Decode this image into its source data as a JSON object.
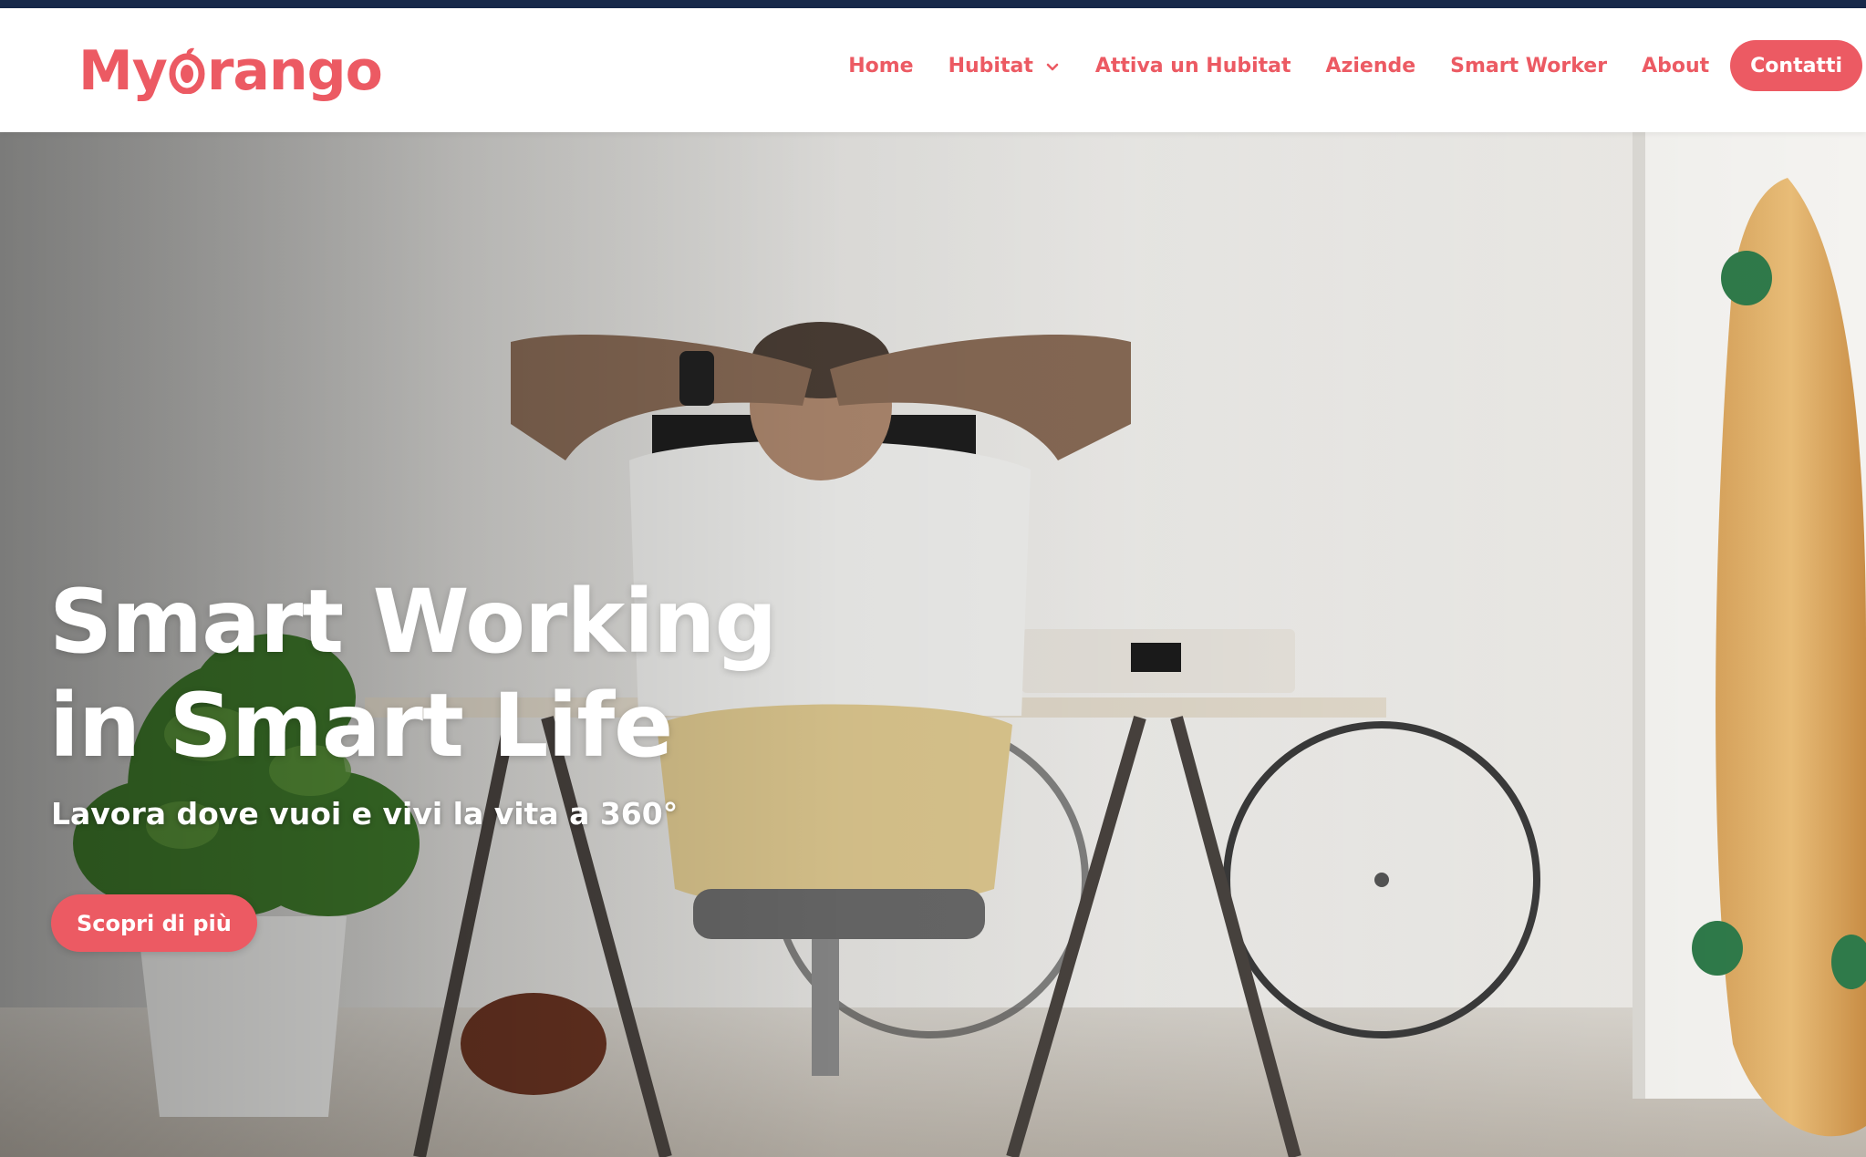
{
  "brand": {
    "name_part1": "My",
    "name_part2": "rango",
    "logo_icon": "orange-o-icon",
    "color": "#ec5a63"
  },
  "nav": {
    "items": [
      {
        "label": "Home"
      },
      {
        "label": "Hubitat",
        "has_dropdown": true
      },
      {
        "label": "Attiva un Hubitat"
      },
      {
        "label": "Aziende"
      },
      {
        "label": "Smart Worker"
      },
      {
        "label": "About"
      }
    ],
    "cta_label": "Contatti"
  },
  "hero": {
    "title_line1": "Smart Working",
    "title_line2": "in Smart Life",
    "subtitle": "Lavora dove vuoi e vivi la vita a 360°",
    "button_label": "Scopri di più",
    "image_description_icon": "hero-photo"
  },
  "colors": {
    "accent": "#ec5a63",
    "topbar": "#17294a"
  }
}
